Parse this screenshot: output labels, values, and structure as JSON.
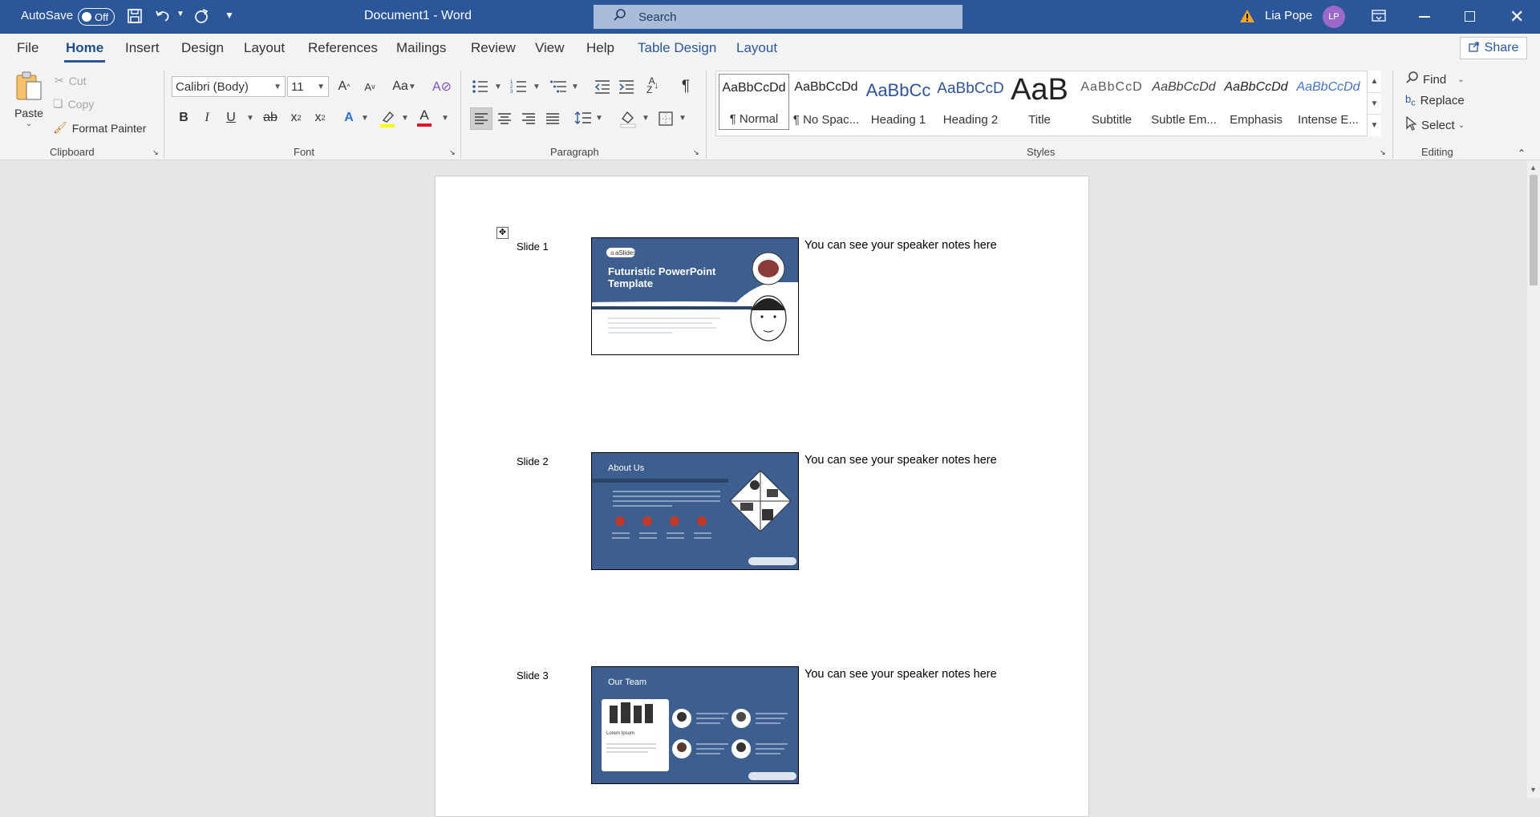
{
  "titlebar": {
    "autosave_label": "AutoSave",
    "autosave_state": "Off",
    "doc_title": "Document1  -  Word",
    "search_placeholder": "Search",
    "user_name": "Lia Pope",
    "user_initials": "LP"
  },
  "tabs": [
    "File",
    "Home",
    "Insert",
    "Design",
    "Layout",
    "References",
    "Mailings",
    "Review",
    "View",
    "Help",
    "Table Design",
    "Layout"
  ],
  "share_label": "Share",
  "clipboard": {
    "paste": "Paste",
    "cut": "Cut",
    "copy": "Copy",
    "format_painter": "Format Painter",
    "group": "Clipboard"
  },
  "font": {
    "name": "Calibri (Body)",
    "size": "11",
    "group": "Font"
  },
  "paragraph": {
    "group": "Paragraph"
  },
  "styles": {
    "group": "Styles",
    "items": [
      {
        "preview": "AaBbCcDd",
        "name": "¶ Normal"
      },
      {
        "preview": "AaBbCcDd",
        "name": "¶ No Spac..."
      },
      {
        "preview": "AaBbCc",
        "name": "Heading 1"
      },
      {
        "preview": "AaBbCcD",
        "name": "Heading 2"
      },
      {
        "preview": "AaB",
        "name": "Title"
      },
      {
        "preview": "AaBbCcD",
        "name": "Subtitle"
      },
      {
        "preview": "AaBbCcDd",
        "name": "Subtle Em..."
      },
      {
        "preview": "AaBbCcDd",
        "name": "Emphasis"
      },
      {
        "preview": "AaBbCcDd",
        "name": "Intense E..."
      }
    ]
  },
  "editing": {
    "find": "Find",
    "replace": "Replace",
    "select": "Select",
    "group": "Editing"
  },
  "slides": [
    {
      "label": "Slide 1",
      "notes": "You can see your speaker notes here",
      "brand": "aSlides",
      "title": "Futuristic PowerPoint Template"
    },
    {
      "label": "Slide 2",
      "notes": "You can see your speaker notes here",
      "title": "About Us"
    },
    {
      "label": "Slide 3",
      "notes": "You can see your speaker notes here",
      "title": "Our Team",
      "sub": "Lorem Ipsum"
    }
  ],
  "colors": {
    "titlebar": "#2b579a",
    "accent": "#2b579a",
    "slide_bg": "#3d5f8f"
  }
}
